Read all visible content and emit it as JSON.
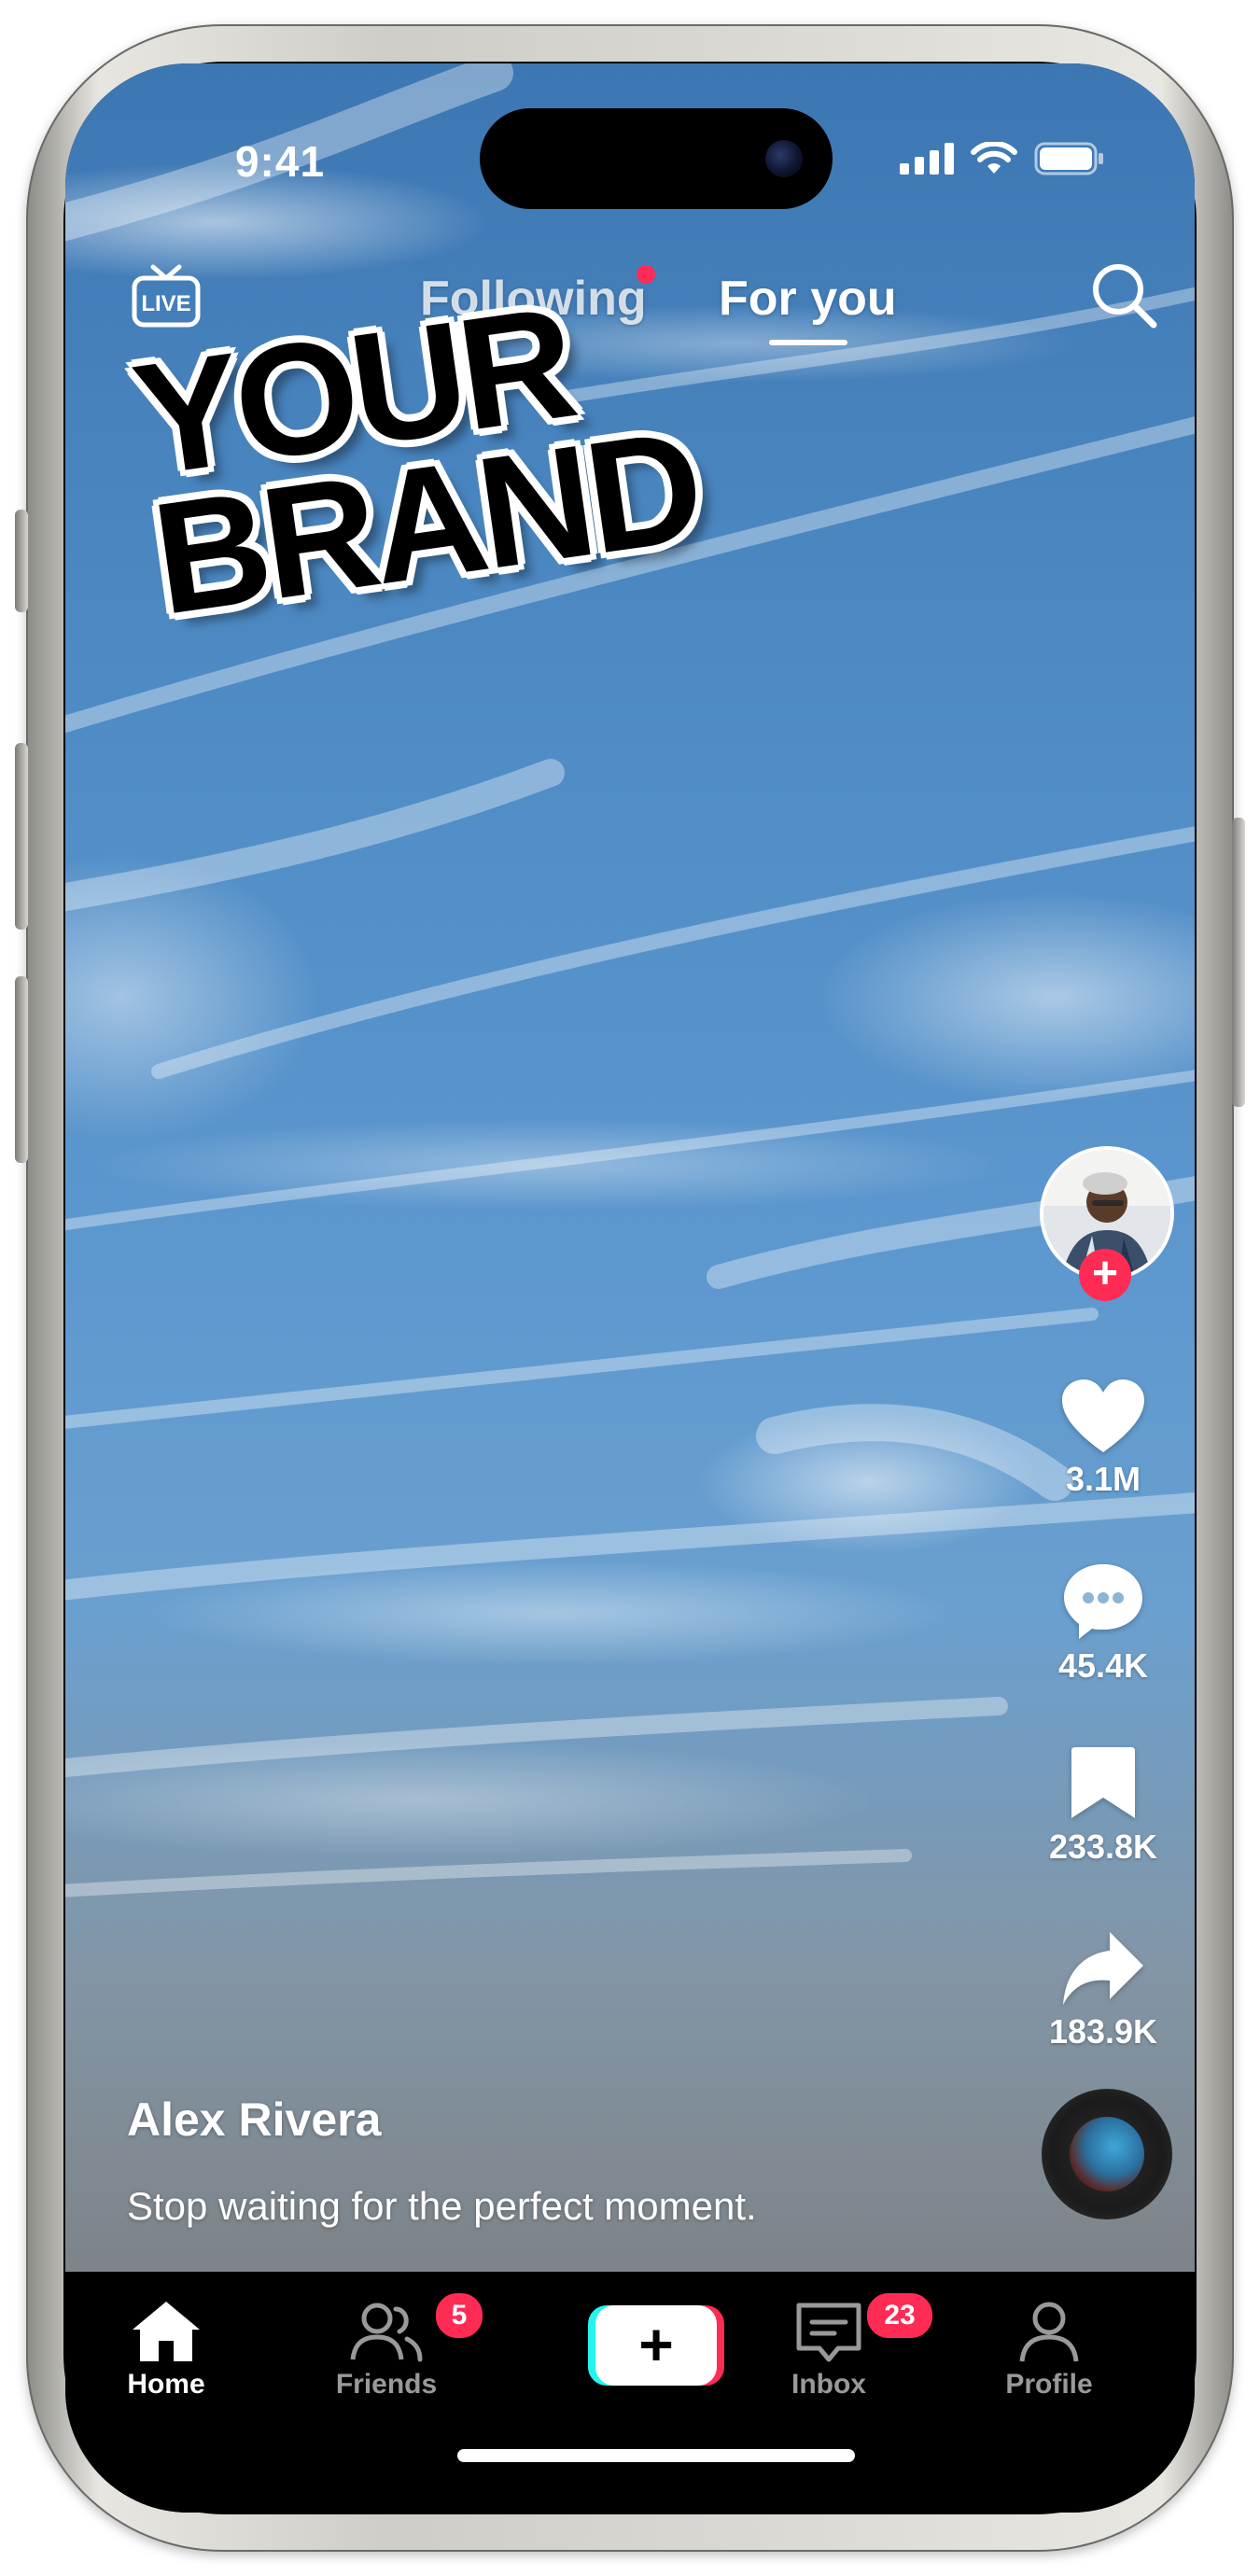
{
  "status_bar": {
    "time": "9:41"
  },
  "header": {
    "live_label": "LIVE",
    "tabs": [
      {
        "label": "Following",
        "active": false,
        "has_notification_dot": true
      },
      {
        "label": "For you",
        "active": true
      }
    ]
  },
  "overlay_sticker": {
    "line1": "YOUR",
    "line2": "BRAND"
  },
  "actions": {
    "likes": "3.1M",
    "comments": "45.4K",
    "saves": "233.8K",
    "shares": "183.9K"
  },
  "post": {
    "author": "Alex Rivera",
    "caption": "Stop waiting for the perfect moment."
  },
  "bottom_nav": {
    "items": [
      {
        "label": "Home",
        "active": true
      },
      {
        "label": "Friends",
        "badge": "5"
      },
      {
        "label": "+",
        "kind": "create"
      },
      {
        "label": "Inbox",
        "badge": "23"
      },
      {
        "label": "Profile"
      }
    ]
  },
  "colors": {
    "accent": "#fe2c55",
    "cyan": "#25f4ee",
    "sky_top": "#3d77b3",
    "nav_bg": "#000000"
  },
  "icons": [
    "live-icon",
    "search-icon",
    "heart-icon",
    "comment-icon",
    "bookmark-icon",
    "share-icon",
    "home-icon",
    "friends-icon",
    "inbox-icon",
    "profile-icon",
    "plus-icon"
  ]
}
